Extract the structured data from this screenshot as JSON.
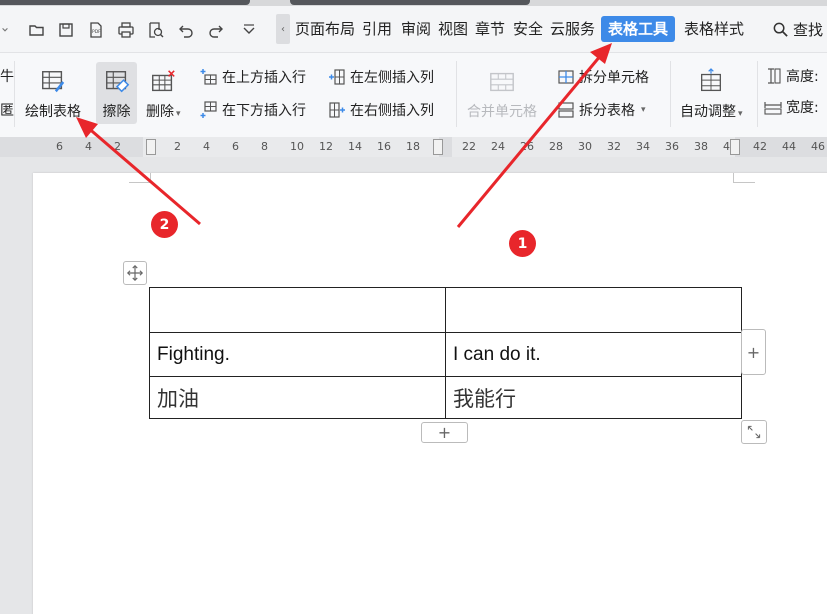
{
  "menu": {
    "items": [
      "页面布局",
      "引用",
      "审阅",
      "视图",
      "章节",
      "安全",
      "云服务",
      "表格工具",
      "表格样式"
    ],
    "active": "表格工具",
    "find_label": "查找"
  },
  "ribbon": {
    "partial_left_top": "牛",
    "partial_left_bottom": "匿",
    "draw_table": "绘制表格",
    "erase": "擦除",
    "delete": "删除",
    "insert_row_above": "在上方插入行",
    "insert_row_below": "在下方插入行",
    "insert_col_left": "在左侧插入列",
    "insert_col_right": "在右侧插入列",
    "merge_cells": "合并单元格",
    "split_cells": "拆分单元格",
    "split_table": "拆分表格",
    "auto_fit": "自动调整",
    "height_label": "高度:",
    "width_label": "宽度:"
  },
  "ruler": {
    "left_numbers": [
      "6",
      "4",
      "2"
    ],
    "mid_numbers": [
      "2",
      "4",
      "6",
      "8",
      "10",
      "12",
      "14",
      "16",
      "18"
    ],
    "right_numbers": [
      "22",
      "24",
      "26",
      "28",
      "30",
      "32",
      "34",
      "36",
      "38",
      "40"
    ],
    "far_numbers": [
      "42",
      "44",
      "46"
    ]
  },
  "table": {
    "rows": [
      [
        "",
        ""
      ],
      [
        "Fighting.",
        "I can do it."
      ],
      [
        "加油",
        "我能行"
      ]
    ]
  },
  "controls": {
    "add_col": "+",
    "add_row": "+"
  },
  "annotations": {
    "badge1": "1",
    "badge2": "2",
    "arrow_color": "#e8262b"
  },
  "colors": {
    "accent": "#3d8ae8",
    "annotation": "#e8262b"
  }
}
